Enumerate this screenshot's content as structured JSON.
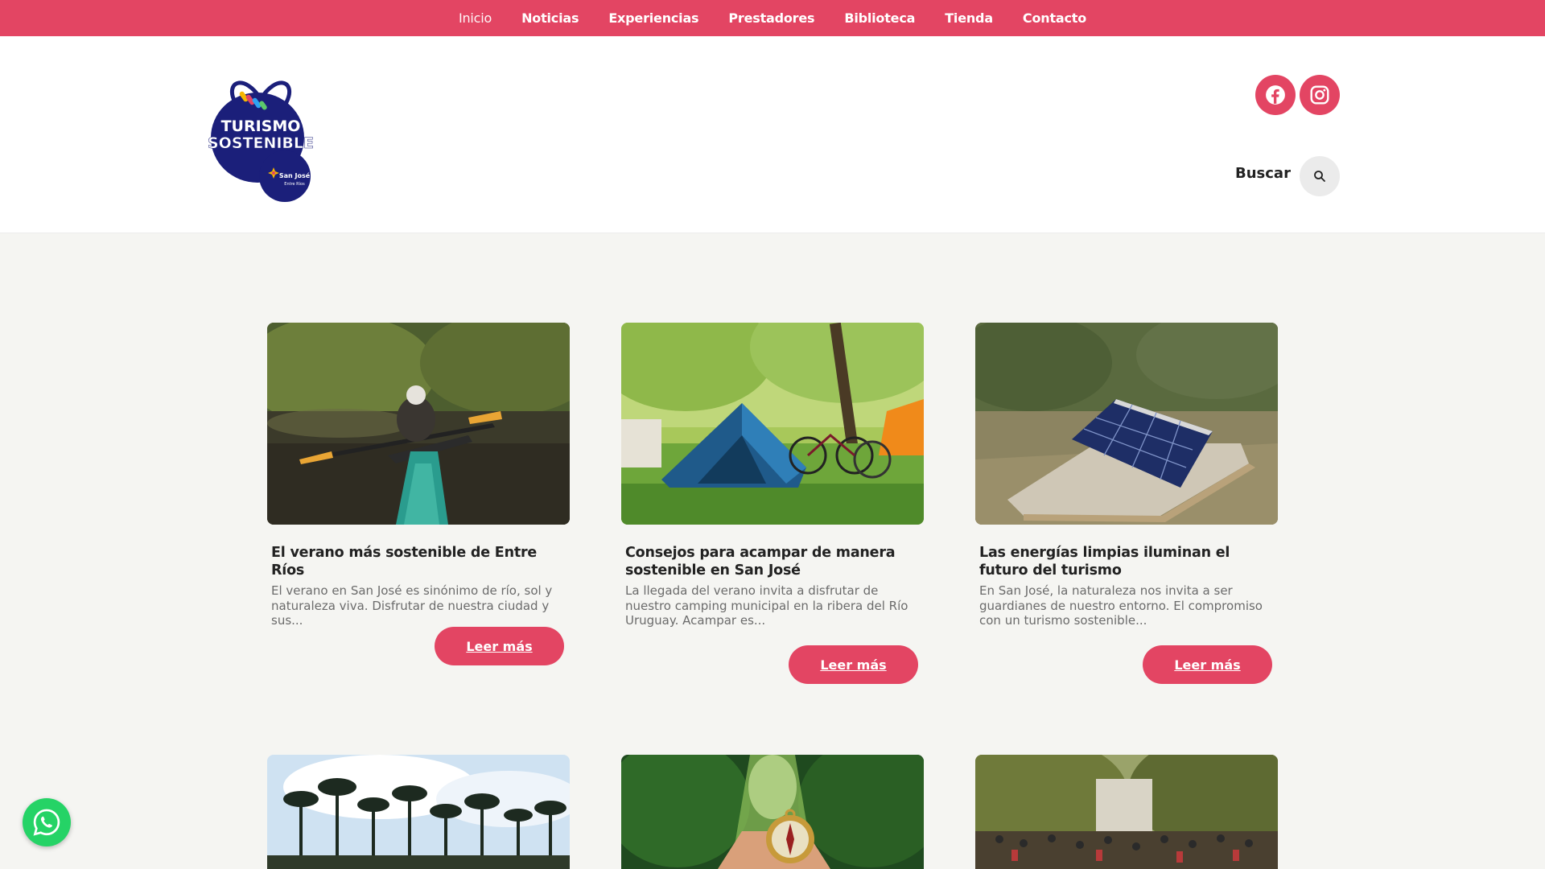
{
  "nav": {
    "items": [
      "Inicio",
      "Noticias",
      "Experiencias",
      "Prestadores",
      "Biblioteca",
      "Tienda",
      "Contacto"
    ],
    "active": "Inicio"
  },
  "logo": {
    "line1": "TURISMO",
    "line2": "SOSTENIBLE",
    "badge": "San José",
    "badge_sub": "Entre Ríos"
  },
  "header": {
    "search_label": "Buscar"
  },
  "social": [
    "facebook-icon",
    "instagram-icon"
  ],
  "cards": [
    {
      "title": "El verano más sostenible de Entre Ríos",
      "excerpt": "El verano en San José es sinónimo de río, sol y naturaleza viva. Disfrutar de nuestra ciudad y sus...",
      "button": "Leer más"
    },
    {
      "title": "Consejos para acampar de manera sostenible en San José",
      "excerpt": "La llegada del verano invita a disfrutar de nuestro camping municipal en la ribera del Río Uruguay. Acampar es...",
      "button": "Leer más"
    },
    {
      "title": "Las energías limpias iluminan el futuro del turismo",
      "excerpt": "En San José, la naturaleza nos invita a ser guardianes de nuestro entorno. El compromiso con un turismo sostenible...",
      "button": "Leer más"
    }
  ],
  "colors": {
    "brand": "#e34563",
    "logo_blue": "#1b1f7a",
    "whatsapp": "#25d366"
  }
}
